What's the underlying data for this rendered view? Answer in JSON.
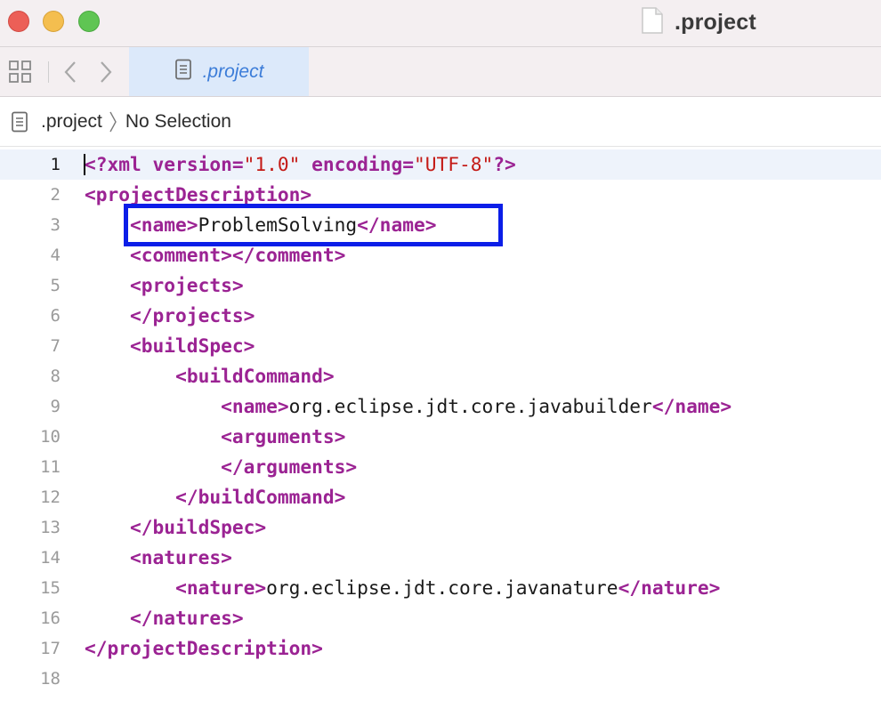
{
  "window": {
    "title": ".project",
    "traffic_lights": {
      "close_color": "#ec5f57",
      "minimize_color": "#f4be4f",
      "zoom_color": "#5fc553"
    }
  },
  "tabbar": {
    "active_tab": ".project",
    "accent_color": "#3b7cd8"
  },
  "pathbar": {
    "file": ".project",
    "selection": "No Selection"
  },
  "editor": {
    "current_line": 1,
    "lines": [
      {
        "n": "1",
        "tokens": [
          {
            "t": "<?xml",
            "c": "tag"
          },
          {
            "t": " ",
            "c": ""
          },
          {
            "t": "version",
            "c": "attr"
          },
          {
            "t": "=",
            "c": "tag"
          },
          {
            "t": "\"1.0\"",
            "c": "str"
          },
          {
            "t": " ",
            "c": ""
          },
          {
            "t": "encoding",
            "c": "attr"
          },
          {
            "t": "=",
            "c": "tag"
          },
          {
            "t": "\"UTF-8\"",
            "c": "str"
          },
          {
            "t": "?>",
            "c": "tag"
          }
        ]
      },
      {
        "n": "2",
        "tokens": [
          {
            "t": "<projectDescription>",
            "c": "tag"
          }
        ]
      },
      {
        "n": "3",
        "tokens": [
          {
            "t": "    ",
            "c": ""
          },
          {
            "t": "<name>",
            "c": "tag"
          },
          {
            "t": "ProblemSolving",
            "c": ""
          },
          {
            "t": "</name>",
            "c": "tag"
          }
        ]
      },
      {
        "n": "4",
        "tokens": [
          {
            "t": "    ",
            "c": ""
          },
          {
            "t": "<comment></comment>",
            "c": "tag"
          }
        ]
      },
      {
        "n": "5",
        "tokens": [
          {
            "t": "    ",
            "c": ""
          },
          {
            "t": "<projects>",
            "c": "tag"
          }
        ]
      },
      {
        "n": "6",
        "tokens": [
          {
            "t": "    ",
            "c": ""
          },
          {
            "t": "</projects>",
            "c": "tag"
          }
        ]
      },
      {
        "n": "7",
        "tokens": [
          {
            "t": "    ",
            "c": ""
          },
          {
            "t": "<buildSpec>",
            "c": "tag"
          }
        ]
      },
      {
        "n": "8",
        "tokens": [
          {
            "t": "        ",
            "c": ""
          },
          {
            "t": "<buildCommand>",
            "c": "tag"
          }
        ]
      },
      {
        "n": "9",
        "tokens": [
          {
            "t": "            ",
            "c": ""
          },
          {
            "t": "<name>",
            "c": "tag"
          },
          {
            "t": "org.eclipse.jdt.core.javabuilder",
            "c": ""
          },
          {
            "t": "</name>",
            "c": "tag"
          }
        ]
      },
      {
        "n": "10",
        "tokens": [
          {
            "t": "            ",
            "c": ""
          },
          {
            "t": "<arguments>",
            "c": "tag"
          }
        ]
      },
      {
        "n": "11",
        "tokens": [
          {
            "t": "            ",
            "c": ""
          },
          {
            "t": "</arguments>",
            "c": "tag"
          }
        ]
      },
      {
        "n": "12",
        "tokens": [
          {
            "t": "        ",
            "c": ""
          },
          {
            "t": "</buildCommand>",
            "c": "tag"
          }
        ]
      },
      {
        "n": "13",
        "tokens": [
          {
            "t": "    ",
            "c": ""
          },
          {
            "t": "</buildSpec>",
            "c": "tag"
          }
        ]
      },
      {
        "n": "14",
        "tokens": [
          {
            "t": "    ",
            "c": ""
          },
          {
            "t": "<natures>",
            "c": "tag"
          }
        ]
      },
      {
        "n": "15",
        "tokens": [
          {
            "t": "        ",
            "c": ""
          },
          {
            "t": "<nature>",
            "c": "tag"
          },
          {
            "t": "org.eclipse.jdt.core.javanature",
            "c": ""
          },
          {
            "t": "</nature>",
            "c": "tag"
          }
        ]
      },
      {
        "n": "16",
        "tokens": [
          {
            "t": "    ",
            "c": ""
          },
          {
            "t": "</natures>",
            "c": "tag"
          }
        ]
      },
      {
        "n": "17",
        "tokens": [
          {
            "t": "</projectDescription>",
            "c": "tag"
          }
        ]
      },
      {
        "n": "18",
        "tokens": []
      }
    ],
    "colors": {
      "tag": "#9b2393",
      "string": "#c41a16",
      "text": "#1a1a1a"
    }
  },
  "annotation": {
    "highlighted_line": 3,
    "color": "#0b1ee8"
  }
}
